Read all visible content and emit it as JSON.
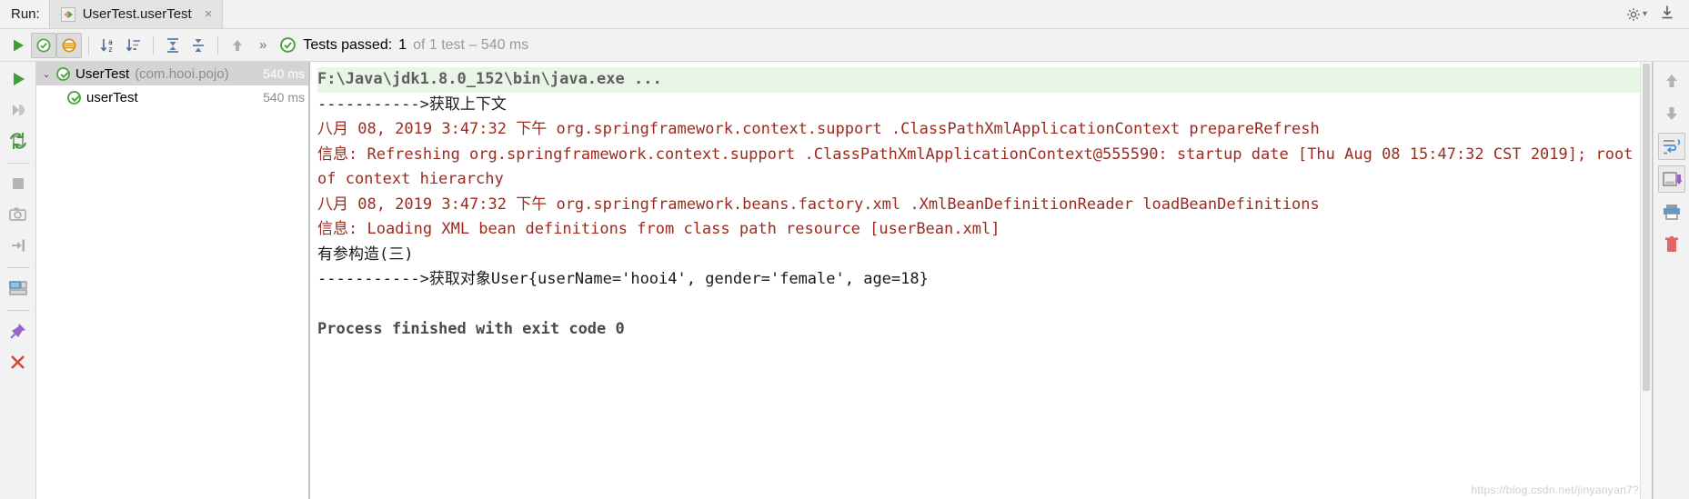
{
  "runbar": {
    "label": "Run:",
    "tab_title": "UserTest.userTest",
    "tab_close": "×",
    "config_icon": "run-configuration-icon",
    "settings_icon": "gear-icon",
    "settings_caret": "▾",
    "export_icon": "export-download-icon"
  },
  "toolbar": {
    "rerun_icon": "run-play-icon",
    "show_passed_icon": "show-passed-tests-icon",
    "show_ignored_icon": "show-ignored-tests-icon",
    "sort_alpha_icon": "sort-alphabetically-icon",
    "sort_duration_icon": "sort-by-duration-icon",
    "expand_all_icon": "expand-all-icon",
    "collapse_all_icon": "collapse-all-icon",
    "up_icon": "previous-failed-test-icon",
    "overflow": "»",
    "status_icon": "tests-passed-icon",
    "status_label": "Tests passed:",
    "status_count": "1",
    "status_detail": "of 1 test – 540 ms"
  },
  "gutter": {
    "items": [
      {
        "icon": "run-play-icon",
        "name": "rerun-tests-button"
      },
      {
        "icon": "rerun-failed-icon",
        "name": "rerun-failed-tests-button"
      },
      {
        "icon": "toggle-auto-test-icon",
        "name": "toggle-auto-test-button"
      },
      {
        "icon": "stop-icon",
        "name": "stop-button"
      },
      {
        "icon": "camera-icon",
        "name": "dump-threads-button"
      },
      {
        "icon": "exit-icon",
        "name": "exit-button"
      },
      {
        "icon": "layout-icon",
        "name": "layout-settings-button"
      },
      {
        "icon": "pin-icon",
        "name": "pin-tab-button"
      },
      {
        "icon": "close-x-icon",
        "name": "close-button"
      }
    ]
  },
  "tree": {
    "rows": [
      {
        "arrow": "⌄",
        "status_icon": "test-passed-icon",
        "name": "UserTest",
        "package": "(com.hooi.pojo)",
        "time": "540 ms",
        "selected": true,
        "child": false
      },
      {
        "arrow": "",
        "status_icon": "test-passed-icon",
        "name": "userTest",
        "package": "",
        "time": "540 ms",
        "selected": false,
        "child": true
      }
    ]
  },
  "console": {
    "lines": [
      {
        "text": "F:\\Java\\jdk1.8.0_152\\bin\\java.exe ...",
        "style": "cmd"
      },
      {
        "text": "----------->获取上下文",
        "style": "plain"
      },
      {
        "text": "八月 08, 2019 3:47:32 下午 org.springframework.context.support .ClassPathXmlApplicationContext prepareRefresh",
        "style": "log"
      },
      {
        "text": "信息: Refreshing org.springframework.context.support .ClassPathXmlApplicationContext@555590: startup date [Thu Aug 08 15:47:32 CST 2019]; root of context hierarchy",
        "style": "log"
      },
      {
        "text": "八月 08, 2019 3:47:32 下午 org.springframework.beans.factory.xml .XmlBeanDefinitionReader loadBeanDefinitions",
        "style": "log"
      },
      {
        "text": "信息: Loading XML bean definitions from class path resource [userBean.xml]",
        "style": "log"
      },
      {
        "text": "有参构造(三)",
        "style": "plain"
      },
      {
        "text": "----------->获取对象User{userName='hooi4', gender='female', age=18}",
        "style": "plain"
      },
      {
        "text": " ",
        "style": "blank"
      },
      {
        "text": "Process finished with exit code 0",
        "style": "exit"
      }
    ]
  },
  "rightbar": {
    "items": [
      {
        "icon": "arrow-up-icon",
        "name": "scroll-up-button",
        "framed": false
      },
      {
        "icon": "arrow-down-icon",
        "name": "scroll-down-button",
        "framed": false
      },
      {
        "icon": "soft-wrap-icon",
        "name": "soft-wrap-button",
        "framed": true
      },
      {
        "icon": "scroll-to-end-icon",
        "name": "scroll-to-end-button",
        "framed": true
      },
      {
        "icon": "print-icon",
        "name": "print-button",
        "framed": false
      },
      {
        "icon": "trash-icon",
        "name": "clear-all-button",
        "framed": false
      }
    ]
  },
  "watermark": "https://blog.csdn.net/jinyanyan7?"
}
